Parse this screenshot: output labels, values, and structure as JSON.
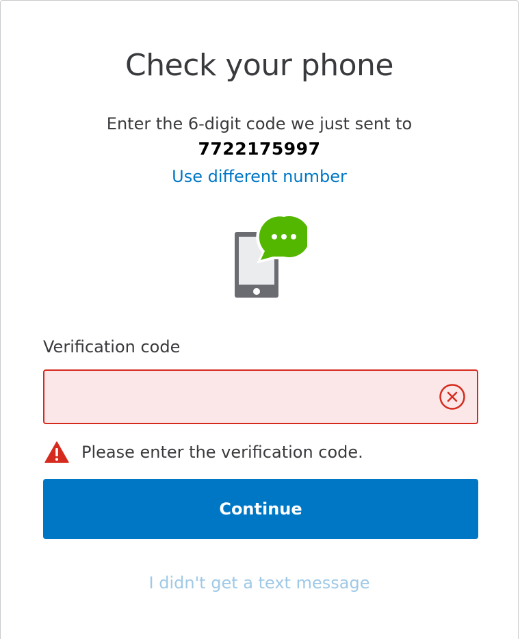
{
  "page": {
    "title": "Check your phone",
    "subtitle": "Enter the 6-digit code we just sent to",
    "phone_number": "7722175997",
    "different_number_link": "Use different number"
  },
  "illustration": {
    "icon": "phone-message-icon",
    "bubble_color": "#53b700",
    "phone_color": "#6b6c72"
  },
  "form": {
    "code_label": "Verification code",
    "code_value": "",
    "code_placeholder": "",
    "clear_icon": "clear-circle-x-icon",
    "error_icon": "warning-triangle-icon",
    "error_message": "Please enter the verification code.",
    "continue_label": "Continue",
    "no_text_link": "I didn't get a text message"
  },
  "colors": {
    "accent": "#0077c5",
    "error": "#d52b1e",
    "error_background": "#fbe7e7",
    "muted_link": "#9fc9e6",
    "text": "#393a3d"
  }
}
